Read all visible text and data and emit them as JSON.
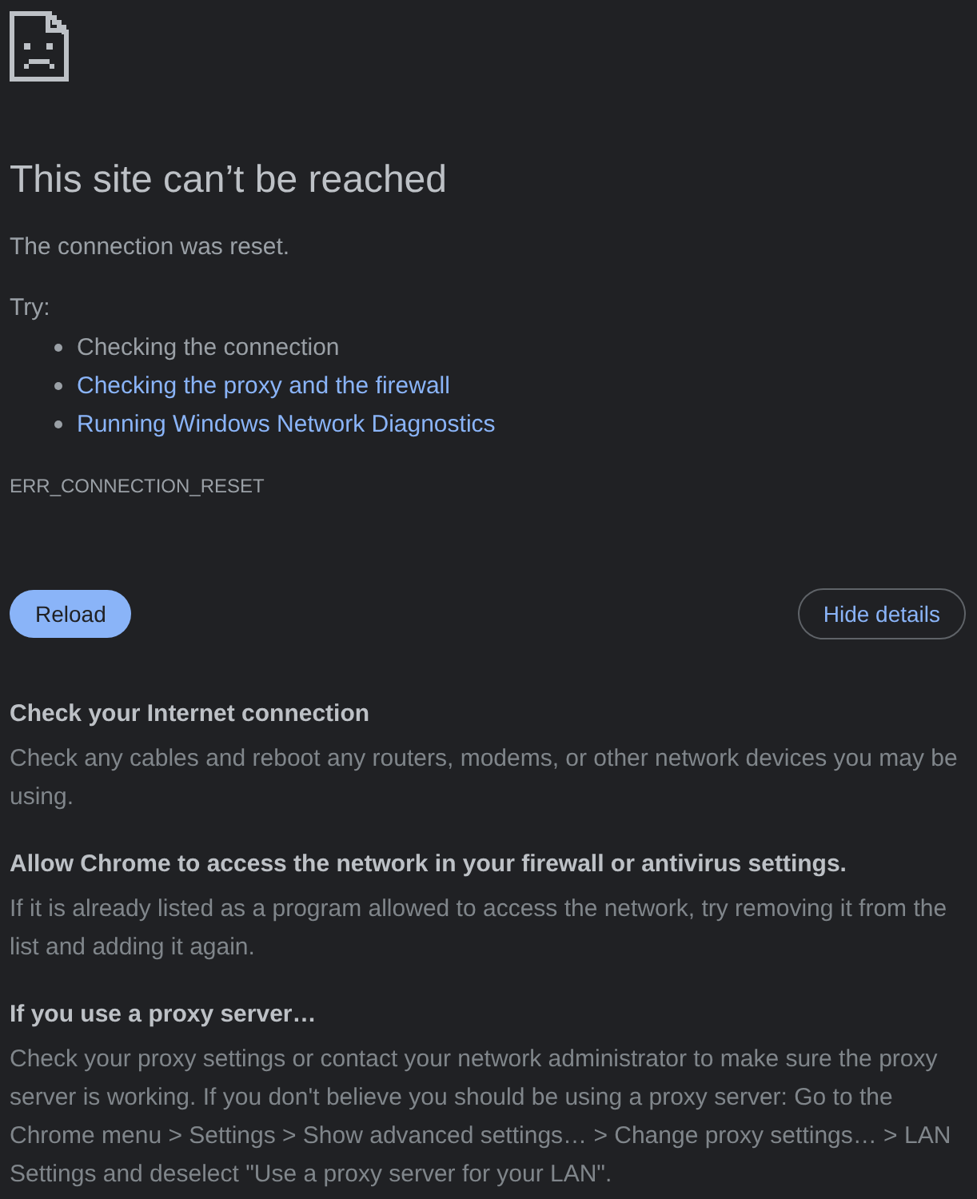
{
  "title": "This site can’t be reached",
  "summary": "The connection was reset.",
  "suggestions": {
    "label": "Try:",
    "items": [
      {
        "kind": "text",
        "text": "Checking the connection"
      },
      {
        "kind": "link",
        "text": "Checking the proxy and the firewall"
      },
      {
        "kind": "link",
        "text": "Running Windows Network Diagnostics"
      }
    ]
  },
  "error_code": "ERR_CONNECTION_RESET",
  "buttons": [
    {
      "kind": "primary",
      "label": "Reload"
    },
    {
      "kind": "secondary",
      "label": "Hide details"
    }
  ],
  "details": [
    {
      "heading": "Check your Internet connection",
      "body": "Check any cables and reboot any routers, modems, or other network devices you may be using."
    },
    {
      "heading": "Allow Chrome to access the network in your firewall or antivirus settings.",
      "body": "If it is already listed as a program allowed to access the network, try removing it from the list and adding it again."
    },
    {
      "heading": "If you use a proxy server…",
      "body": "Check your proxy settings or contact your network administrator to make sure the proxy server is working. If you don't believe you should be using a proxy server: Go to the Chrome menu > Settings > Show advanced settings… > Change proxy settings… > LAN Settings and deselect \"Use a proxy server for your LAN\"."
    }
  ]
}
